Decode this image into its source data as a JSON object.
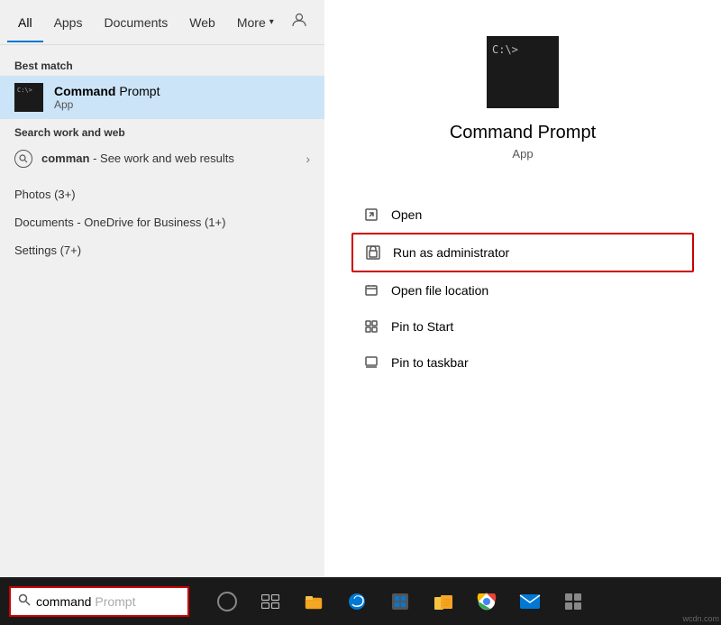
{
  "tabs": {
    "items": [
      {
        "label": "All",
        "active": true
      },
      {
        "label": "Apps",
        "active": false
      },
      {
        "label": "Documents",
        "active": false
      },
      {
        "label": "Web",
        "active": false
      },
      {
        "label": "More",
        "active": false,
        "hasArrow": true
      }
    ]
  },
  "results": {
    "best_match_label": "Best match",
    "best_match": {
      "name_bold": "Command",
      "name_rest": " Prompt",
      "type": "App"
    },
    "search_web_label": "Search work and web",
    "search_web_item": {
      "bold": "comman",
      "rest": " - See work and web results"
    },
    "other": [
      {
        "label": "Photos (3+)"
      },
      {
        "label": "Documents - OneDrive for Business (1+)"
      },
      {
        "label": "Settings (7+)"
      }
    ]
  },
  "detail": {
    "app_name": "Command Prompt",
    "app_type": "App",
    "actions": [
      {
        "label": "Open",
        "highlighted": false
      },
      {
        "label": "Run as administrator",
        "highlighted": true
      },
      {
        "label": "Open file location",
        "highlighted": false
      },
      {
        "label": "Pin to Start",
        "highlighted": false
      },
      {
        "label": "Pin to taskbar",
        "highlighted": false
      }
    ]
  },
  "taskbar": {
    "search_typed": "command",
    "search_placeholder": " Prompt"
  }
}
